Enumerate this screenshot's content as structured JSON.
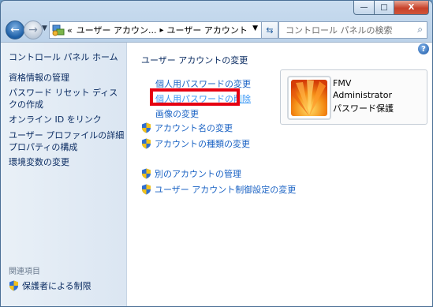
{
  "window": {
    "controls": {
      "minimize": "—",
      "maximize": "□",
      "close": "X"
    }
  },
  "nav": {
    "back_icon": "back-arrow-icon",
    "forward_icon": "forward-arrow-icon",
    "breadcrumb": {
      "prefix": "«",
      "item1": "ユーザー アカウン...",
      "sep": "▸",
      "item2": "ユーザー アカウント"
    },
    "search_placeholder": "コントロール パネルの検索"
  },
  "sidebar": {
    "home": "コントロール パネル ホーム",
    "links": [
      "資格情報の管理",
      "パスワード リセット ディスクの作成",
      "オンライン ID をリンク",
      "ユーザー プロファイルの詳細プロパティの構成",
      "環境変数の変更"
    ],
    "related_title": "関連項目",
    "related_link": "保護者による制限"
  },
  "main": {
    "heading": "ユーザー アカウントの変更",
    "tasks": {
      "change_password": "個人用パスワードの変更",
      "remove_password": "個人用パスワードの削除",
      "change_picture": "画像の変更",
      "change_name": "アカウント名の変更",
      "change_type": "アカウントの種類の変更",
      "manage_other": "別のアカウントの管理",
      "uac_settings": "ユーザー アカウント制御設定の変更"
    },
    "user": {
      "line1": "FMV",
      "line2": "Administrator",
      "line3": "パスワード保護"
    }
  },
  "colors": {
    "link": "#1b63c4",
    "highlight": "#e60012",
    "sidebar_text": "#0b2c62"
  }
}
